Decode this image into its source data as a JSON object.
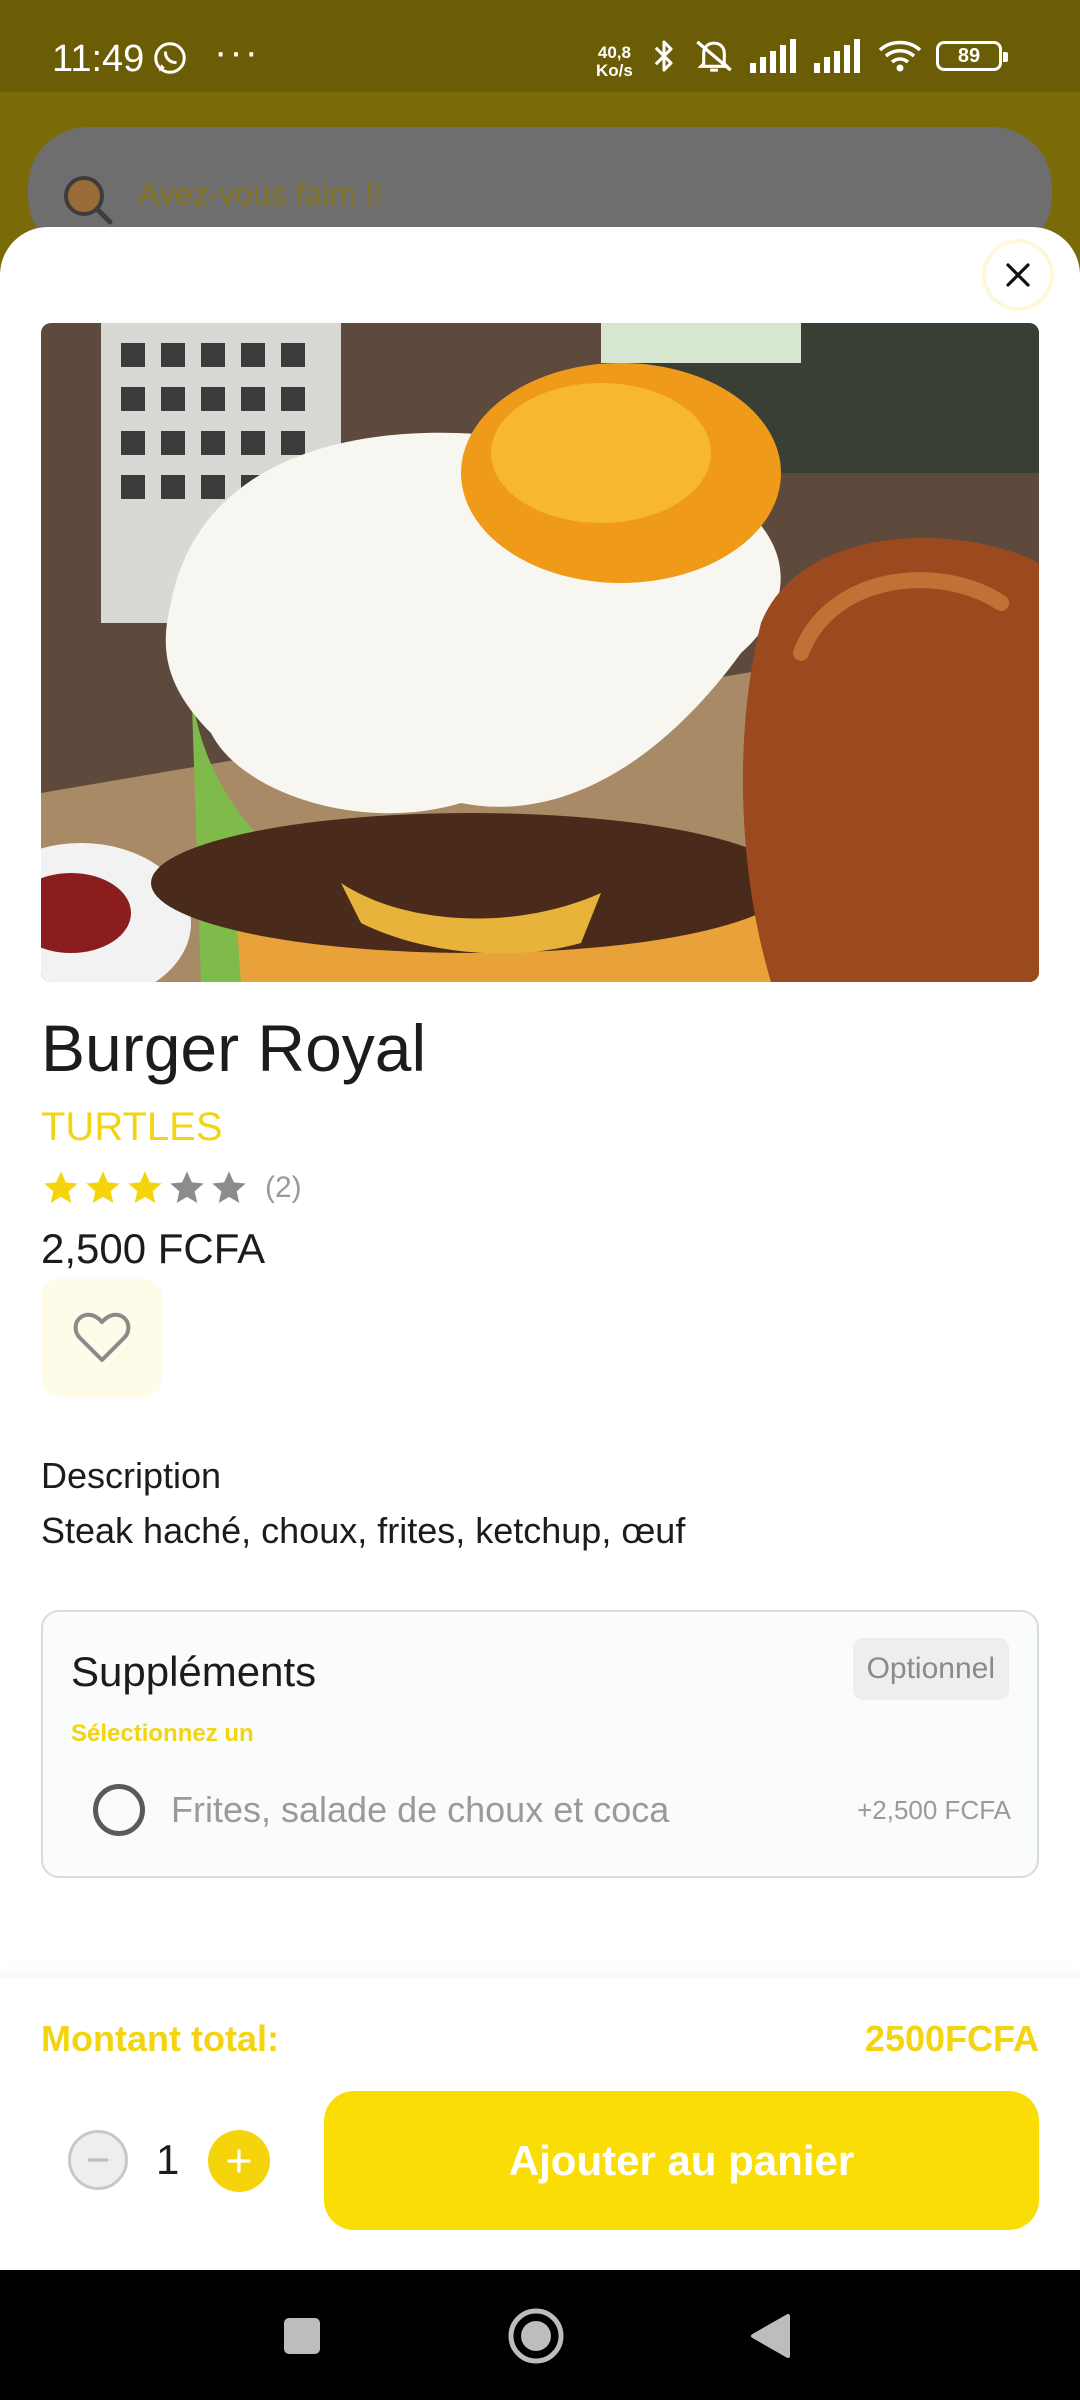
{
  "status_bar": {
    "time": "11:49",
    "dots": "···",
    "net_speed_value": "40,8",
    "net_speed_unit": "Ko/s",
    "battery": "89"
  },
  "background": {
    "search_placeholder": "Avez-vous faim !!"
  },
  "product": {
    "name": "Burger Royal",
    "restaurant": "TURTLES",
    "rating": 3,
    "rating_max": 5,
    "rating_count": "(2)",
    "price": "2,500 FCFA"
  },
  "description": {
    "title": "Description",
    "text": "Steak haché, choux, frites, ketchup, œuf"
  },
  "supplements": {
    "title": "Suppléments",
    "badge": "Optionnel",
    "hint": "Sélectionnez un",
    "options": [
      {
        "label": "Frites, salade de choux et coca",
        "price": "+2,500 FCFA",
        "selected": false
      }
    ]
  },
  "footer": {
    "total_label": "Montant total:",
    "total_value": "2500FCFA",
    "quantity": "1",
    "add_button": "Ajouter au panier"
  },
  "colors": {
    "accent": "#f6d40b",
    "accent_text": "#f3d410"
  }
}
